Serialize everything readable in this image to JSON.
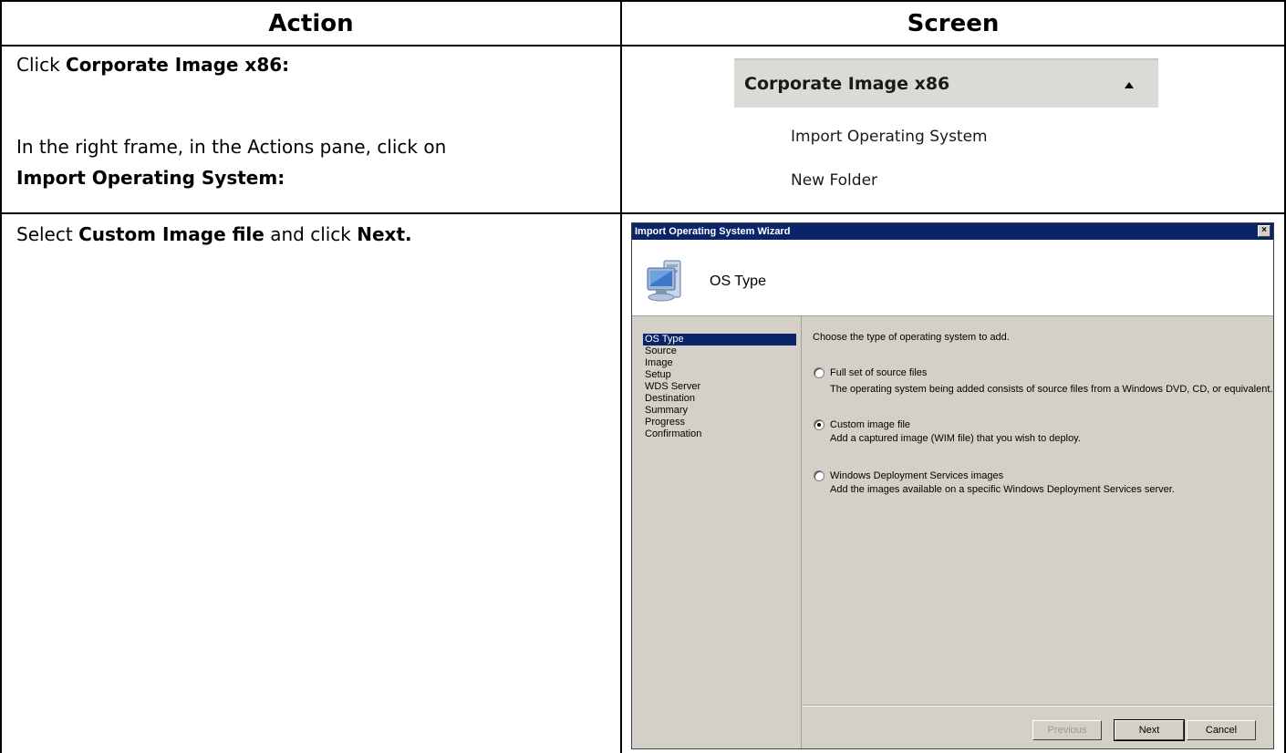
{
  "table": {
    "headers": [
      "Action",
      "Screen"
    ]
  },
  "row1": {
    "lines": [
      {
        "prefix": "Click  ",
        "bold": "Corporate Image x86:",
        "suffix": ""
      },
      {
        "prefix": "In the right frame, in the Actions pane, click on",
        "bold": "",
        "suffix": ""
      },
      {
        "prefix": "",
        "bold": "Import Operating System:",
        "suffix": ""
      }
    ]
  },
  "row2": {
    "parts": [
      "Select ",
      "Custom Image file",
      " and click ",
      "Next."
    ]
  },
  "actions_pane": {
    "title": "Corporate Image x86",
    "items": [
      "Import Operating System",
      "New Folder"
    ]
  },
  "wizard": {
    "title": "Import Operating System Wizard",
    "close": "×",
    "heading": "OS Type",
    "steps": [
      "OS Type",
      "Source",
      "Image",
      "Setup",
      "WDS Server",
      "Destination",
      "Summary",
      "Progress",
      "Confirmation"
    ],
    "active_step": 0,
    "prompt": "Choose the type of operating system to add.",
    "options": [
      {
        "label": "Full set of source files",
        "description": "The operating system being added consists of source files from a Windows DVD, CD, or equivalent.",
        "checked": false
      },
      {
        "label": "Custom image file",
        "description": "Add a captured image (WIM file) that you wish to deploy.",
        "checked": true
      },
      {
        "label": "Windows Deployment Services images",
        "description": "Add the images available on a specific Windows Deployment Services server.",
        "checked": false
      }
    ],
    "buttons": {
      "previous": "Previous",
      "next": "Next",
      "cancel": "Cancel"
    },
    "colors": {
      "titlebar": "#0a246a",
      "face": "#d4d0c8"
    }
  }
}
